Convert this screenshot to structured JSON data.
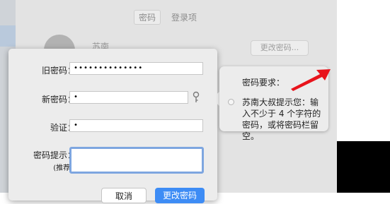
{
  "background": {
    "tabs": [
      "密码",
      "登录项"
    ],
    "user_name": "苏南",
    "change_password_button": "更改密码..."
  },
  "dialog": {
    "old_password": {
      "label": "旧密码：",
      "value": "••••••••••••••"
    },
    "new_password": {
      "label": "新密码：",
      "value": "•"
    },
    "verify": {
      "label": "验证：",
      "value": "•"
    },
    "hint": {
      "label": "密码提示：",
      "sublabel": "(推荐)",
      "value": ""
    },
    "cancel_button": "取消",
    "confirm_button": "更改密码"
  },
  "popover": {
    "title": "密码要求：",
    "body": "苏南大叔提示您：输入不少于 4 个字符的密码，或将密码栏留空。"
  },
  "colors": {
    "accent": "#3d8cf5",
    "focus_ring": "#7ea6e0",
    "annotation_arrow": "#e8141c"
  },
  "icons": [
    "key-icon",
    "red-arrow-annotation"
  ]
}
